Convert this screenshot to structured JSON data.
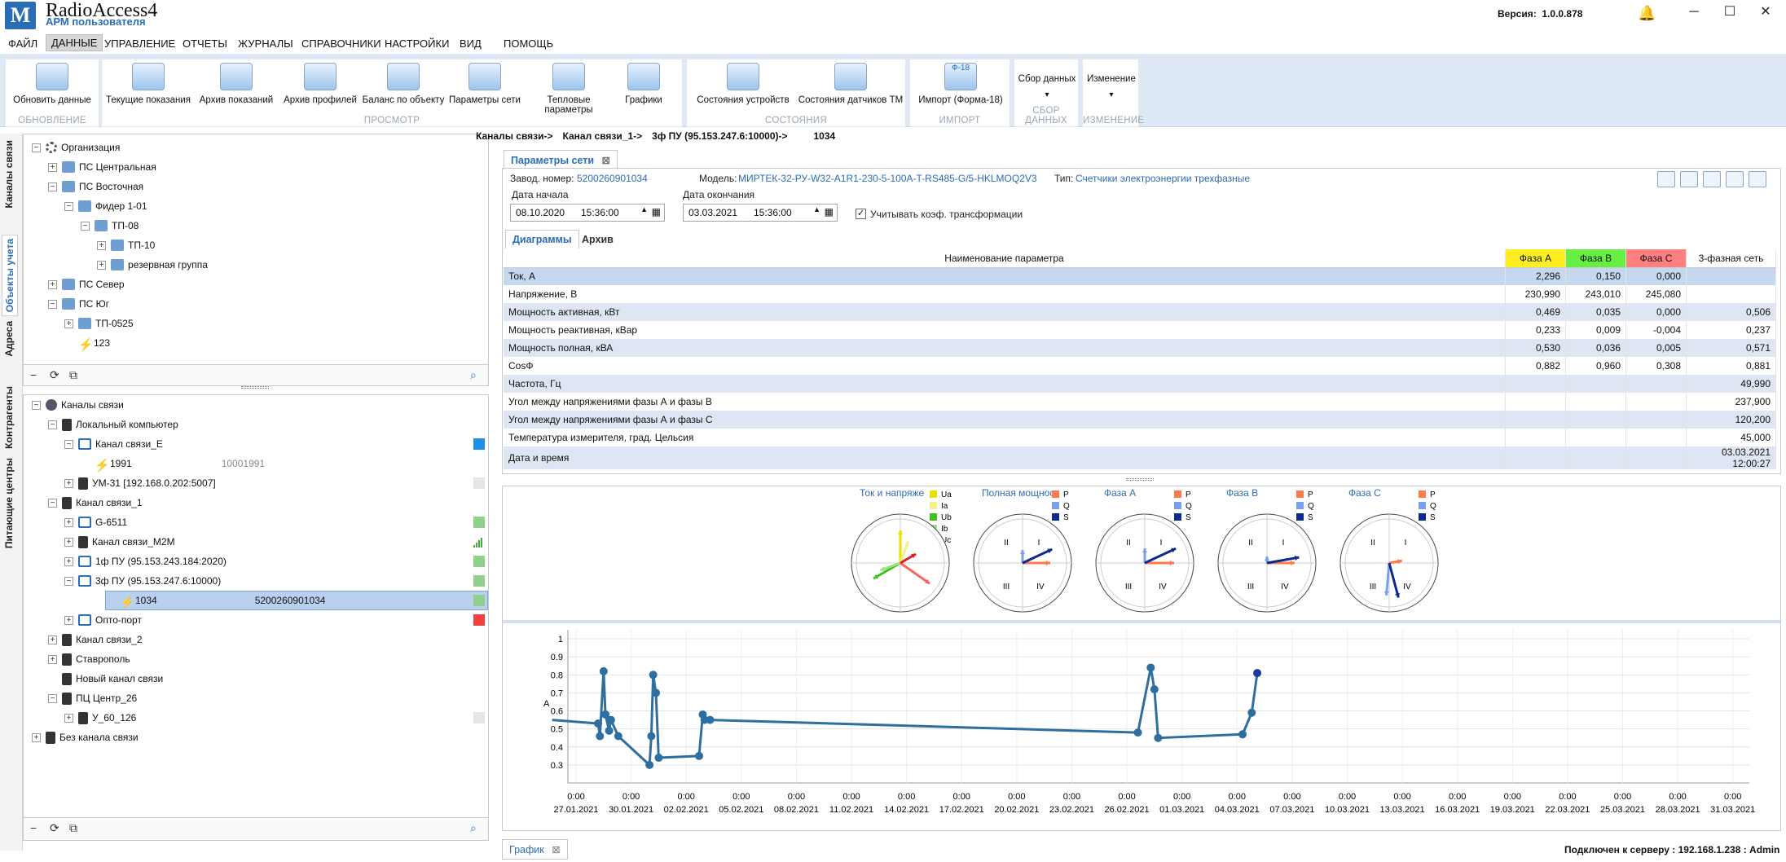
{
  "app": {
    "title": "RadioAccess4",
    "subtitle": "АРМ пользователя",
    "logo_text": "M",
    "version_label": "Версия:",
    "version": "1.0.0.878",
    "bell_icon": "bell-icon"
  },
  "window_controls": {
    "minimize": "─",
    "maximize": "☐",
    "close": "✕"
  },
  "menu": [
    "ФАЙЛ",
    "ДАННЫЕ",
    "УПРАВЛЕНИЕ",
    "ОТЧЕТЫ",
    "ЖУРНАЛЫ",
    "СПРАВОЧНИКИ",
    "НАСТРОЙКИ",
    "ВИД",
    "ПОМОЩЬ"
  ],
  "menu_active": "ДАННЫЕ",
  "ribbon": {
    "groups": [
      {
        "label": "ОБНОВЛЕНИЕ",
        "buttons": [
          "Обновить данные"
        ]
      },
      {
        "label": "ПРОСМОТР",
        "buttons": [
          "Текущие показания",
          "Архив показаний",
          "Архив профилей",
          "Баланс по объекту",
          "Параметры сети",
          "Тепловые параметры",
          "Графики"
        ]
      },
      {
        "label": "СОСТОЯНИЯ",
        "buttons": [
          "Состояния устройств",
          "Состояния датчиков ТМ"
        ]
      },
      {
        "label": "ИМПОРТ",
        "buttons": [
          "Импорт (Форма-18)"
        ],
        "badge": "Ф-18"
      },
      {
        "label": "СБОР ДАННЫХ",
        "buttons": [
          "Сбор данных"
        ]
      },
      {
        "label": "ИЗМЕНЕНИЕ",
        "buttons": [
          "Изменение"
        ]
      }
    ],
    "dropdown_arrow": "▾"
  },
  "left_tabs": [
    "Каналы связи",
    "Объекты учета",
    "Адреса",
    "Контрагенты",
    "Питающие центры"
  ],
  "left_tab_active": "Объекты учета",
  "tree_objects": [
    {
      "label": "Организация",
      "level": 0,
      "exp": "−",
      "icon": "org"
    },
    {
      "label": "ПС Центральная",
      "level": 1,
      "exp": "+",
      "icon": "folder"
    },
    {
      "label": "ПС Восточная",
      "level": 1,
      "exp": "−",
      "icon": "folder"
    },
    {
      "label": "Фидер 1-01",
      "level": 2,
      "exp": "−",
      "icon": "folder"
    },
    {
      "label": "ТП-08",
      "level": 3,
      "exp": "−",
      "icon": "folder"
    },
    {
      "label": "ТП-10",
      "level": 4,
      "exp": "+",
      "icon": "folder"
    },
    {
      "label": "резервная группа",
      "level": 4,
      "exp": "+",
      "icon": "folder"
    },
    {
      "label": "ПС Север",
      "level": 1,
      "exp": "+",
      "icon": "folder"
    },
    {
      "label": "ПС Юг",
      "level": 1,
      "exp": "−",
      "icon": "folder"
    },
    {
      "label": "ТП-0525",
      "level": 2,
      "exp": "+",
      "icon": "folder"
    },
    {
      "label": "123",
      "level": 2,
      "exp": "",
      "icon": "bolt"
    }
  ],
  "tree_channels": [
    {
      "label": "Каналы связи",
      "level": 0,
      "exp": "−",
      "icon": "globe"
    },
    {
      "label": "Локальный компьютер",
      "level": 1,
      "exp": "−",
      "icon": "dev"
    },
    {
      "label": "Канал связи_Е",
      "level": 2,
      "exp": "−",
      "icon": "modem",
      "status": "#1e90e8"
    },
    {
      "label": "1991",
      "level": 3,
      "exp": "",
      "icon": "bolt",
      "extra": "10001991"
    },
    {
      "label": "УМ-31 [192.168.0.202:5007]",
      "level": 2,
      "exp": "+",
      "icon": "dev",
      "status": "#e6e6e6"
    },
    {
      "label": "Канал связи_1",
      "level": 1,
      "exp": "−",
      "icon": "dev"
    },
    {
      "label": "G-6511",
      "level": 2,
      "exp": "+",
      "icon": "modem",
      "status": "#8fd08f"
    },
    {
      "label": "Канал связи_M2M",
      "level": 2,
      "exp": "+",
      "icon": "dev",
      "status": "signal"
    },
    {
      "label": "1ф ПУ (95.153.243.184:2020)",
      "level": 2,
      "exp": "+",
      "icon": "modem",
      "status": "#8fd08f"
    },
    {
      "label": "3ф ПУ (95.153.247.6:10000)",
      "level": 2,
      "exp": "−",
      "icon": "modem",
      "status": "#8fd08f"
    },
    {
      "label": "1034",
      "level": 3,
      "exp": "",
      "icon": "bolt",
      "extra": "5200260901034",
      "selected": true,
      "status": "#8fd08f"
    },
    {
      "label": "Опто-порт",
      "level": 2,
      "exp": "+",
      "icon": "modem",
      "status": "#f04040"
    },
    {
      "label": "Канал связи_2",
      "level": 1,
      "exp": "+",
      "icon": "dev"
    },
    {
      "label": "Ставрополь",
      "level": 1,
      "exp": "+",
      "icon": "dev"
    },
    {
      "label": "Новый канал связи",
      "level": 1,
      "exp": "",
      "icon": "dev"
    },
    {
      "label": "ПЦ Центр_26",
      "level": 1,
      "exp": "−",
      "icon": "dev"
    },
    {
      "label": "У_60_126",
      "level": 2,
      "exp": "+",
      "icon": "dev",
      "status": "#e6e6e6"
    },
    {
      "label": "Без канала связи",
      "level": 0,
      "exp": "+",
      "icon": "dev"
    }
  ],
  "tree_toolbar_icons": [
    "collapse-icon",
    "refresh-icon",
    "copy-icon",
    "search-icon"
  ],
  "breadcrumb": [
    "Каналы связи->",
    "Канал связи_1->",
    "3ф ПУ (95.153.247.6:10000)->",
    "1034"
  ],
  "doc_tab": {
    "label": "Параметры сети",
    "close": "⊠"
  },
  "device": {
    "serial_label": "Завод. номер:",
    "serial": "5200260901034",
    "model_label": "Модель:",
    "model": "МИРТЕК-32-РУ-W32-A1R1-230-5-100A-T-RS485-G/5-HKLMOQ2V3",
    "type_label": "Тип:",
    "type": "Счетчики электроэнергии трехфазные"
  },
  "dates": {
    "start_label": "Дата начала",
    "start_date": "08.10.2020",
    "start_time": "15:36:00",
    "end_label": "Дата окончания",
    "end_date": "03.03.2021",
    "end_time": "15:36:00",
    "checkbox_label": "Учитывать коэф. трансформации",
    "checkbox_checked": true
  },
  "export_icons": [
    "print-preview-icon",
    "excel-icon",
    "pdf-icon",
    "csv-icon",
    "printer-icon"
  ],
  "inner_tabs": [
    "Диаграммы",
    "Архив"
  ],
  "table": {
    "headers": [
      "Наименование параметра",
      "Фаза A",
      "Фаза B",
      "Фаза C",
      "3-фазная сеть"
    ],
    "header_colors": [
      "#ffffff",
      "#ffee22",
      "#66ee44",
      "#ff8080",
      "#ffffff"
    ],
    "rows": [
      [
        "Ток, А",
        "2,296",
        "0,150",
        "0,000",
        ""
      ],
      [
        "Напряжение, В",
        "230,990",
        "243,010",
        "245,080",
        ""
      ],
      [
        "Мощность активная, кВт",
        "0,469",
        "0,035",
        "0,000",
        "0,506"
      ],
      [
        "Мощность реактивная, кВар",
        "0,233",
        "0,009",
        "-0,004",
        "0,237"
      ],
      [
        "Мощность полная, кВА",
        "0,530",
        "0,036",
        "0,005",
        "0,571"
      ],
      [
        "CosФ",
        "0,882",
        "0,960",
        "0,308",
        "0,881"
      ],
      [
        "Частота, Гц",
        "",
        "",
        "",
        "49,990"
      ],
      [
        "Угол между напряжениями фазы А и фазы В",
        "",
        "",
        "",
        "237,900"
      ],
      [
        "Угол между напряжениями фазы А и фазы С",
        "",
        "",
        "",
        "120,200"
      ],
      [
        "Температура измерителя, град. Цельсия",
        "",
        "",
        "",
        "45,000"
      ],
      [
        "Дата и время",
        "",
        "",
        "",
        "03.03.2021 12:00:27"
      ]
    ]
  },
  "vector_diagrams": [
    {
      "title": "Ток и напряже",
      "legend": [
        [
          "Ua",
          "#e8e000"
        ],
        [
          "Ia",
          "#f6f08a"
        ],
        [
          "Ub",
          "#40c020"
        ],
        [
          "Ib",
          "#a0e080"
        ],
        [
          "Uc",
          "#f06868"
        ],
        [
          "Ic",
          "#e02020"
        ]
      ]
    },
    {
      "title": "Полная мощнос",
      "legend": [
        [
          "P",
          "#ff7a4a"
        ],
        [
          "Q",
          "#7a9ff0"
        ],
        [
          "S",
          "#0b2a8c"
        ]
      ]
    },
    {
      "title": "Фаза A",
      "legend": [
        [
          "P",
          "#ff7a4a"
        ],
        [
          "Q",
          "#7a9ff0"
        ],
        [
          "S",
          "#0b2a8c"
        ]
      ]
    },
    {
      "title": "Фаза B",
      "legend": [
        [
          "P",
          "#ff7a4a"
        ],
        [
          "Q",
          "#7a9ff0"
        ],
        [
          "S",
          "#0b2a8c"
        ]
      ]
    },
    {
      "title": "Фаза C",
      "legend": [
        [
          "P",
          "#ff7a4a"
        ],
        [
          "Q",
          "#7a9ff0"
        ],
        [
          "S",
          "#0b2a8c"
        ]
      ]
    }
  ],
  "quadrant_labels": [
    "I",
    "II",
    "III",
    "IV"
  ],
  "chart_data": {
    "type": "line",
    "ylabel": "A",
    "ylim": [
      0.2,
      1.05
    ],
    "yticks": [
      "0.3",
      "0.4",
      "0.5",
      "0.6",
      "0.7",
      "0.8",
      "0.9",
      "1"
    ],
    "xtick_time": "0:00",
    "xticks": [
      "27.01.2021",
      "30.01.2021",
      "02.02.2021",
      "05.02.2021",
      "08.02.2021",
      "11.02.2021",
      "14.02.2021",
      "17.02.2021",
      "20.02.2021",
      "23.02.2021",
      "26.02.2021",
      "01.03.2021",
      "04.03.2021",
      "07.03.2021",
      "10.03.2021",
      "13.03.2021",
      "16.03.2021",
      "19.03.2021",
      "22.03.2021",
      "25.03.2021",
      "28.03.2021",
      "31.03.2021"
    ],
    "series": [
      {
        "color": "#2e6fa0",
        "x_days": [
          -1.3,
          1.2,
          1.3,
          1.5,
          1.6,
          1.8,
          1.9,
          2.3,
          4.0,
          4.1,
          4.2,
          4.35,
          4.5,
          6.7,
          6.9,
          7.0,
          7.3,
          30.6,
          31.3,
          31.5,
          31.7,
          36.3,
          36.8,
          37.1
        ],
        "values": [
          0.55,
          0.53,
          0.46,
          0.82,
          0.58,
          0.49,
          0.55,
          0.46,
          0.3,
          0.46,
          0.8,
          0.7,
          0.34,
          0.35,
          0.58,
          0.55,
          0.55,
          0.48,
          0.84,
          0.72,
          0.45,
          0.47,
          0.59,
          0.81
        ]
      }
    ],
    "grid": true
  },
  "bottom_tab": {
    "label": "График",
    "close": "⊠"
  },
  "status": "Подключен к серверу : 192.168.1.238 : Admin"
}
